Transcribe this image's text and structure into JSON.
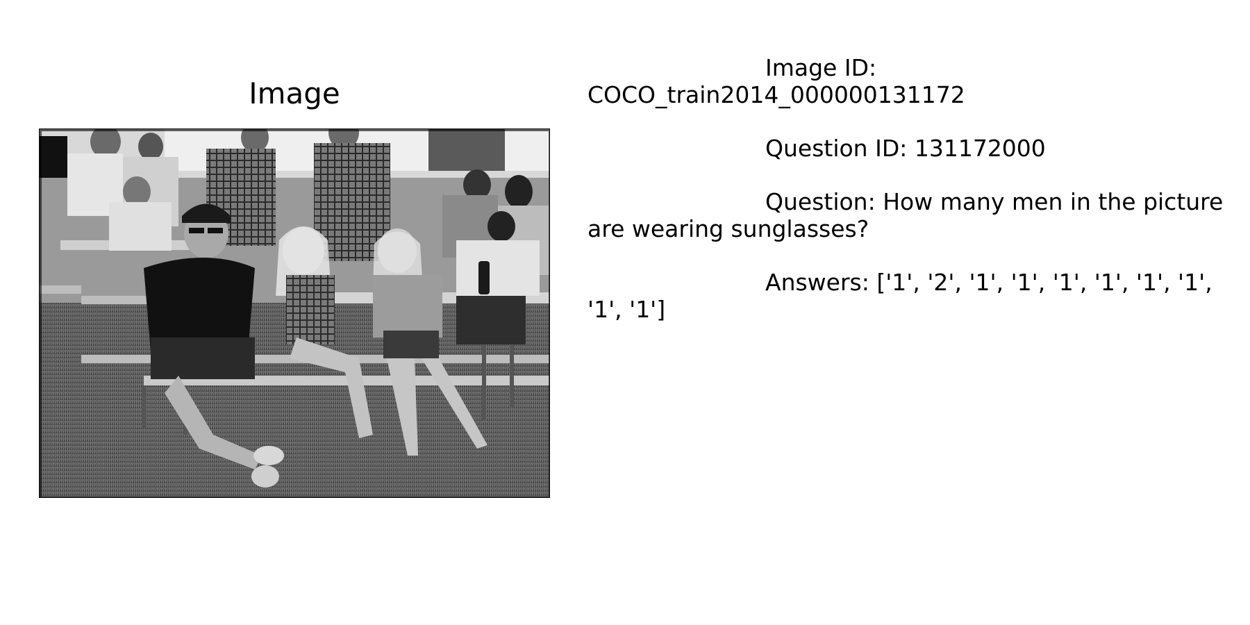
{
  "image_panel": {
    "title": "Image"
  },
  "details": {
    "image_id": "Image ID: COCO_train2014_000000131172",
    "question_id": "Question ID: 131172000",
    "question": "Question: How many men in the picture are wearing sunglasses?",
    "answers": "Answers: ['1', '2', '1', '1', '1', '1', '1', '1', '1', '1']"
  },
  "colors": {
    "background": "#ffffff",
    "text": "#000000"
  }
}
